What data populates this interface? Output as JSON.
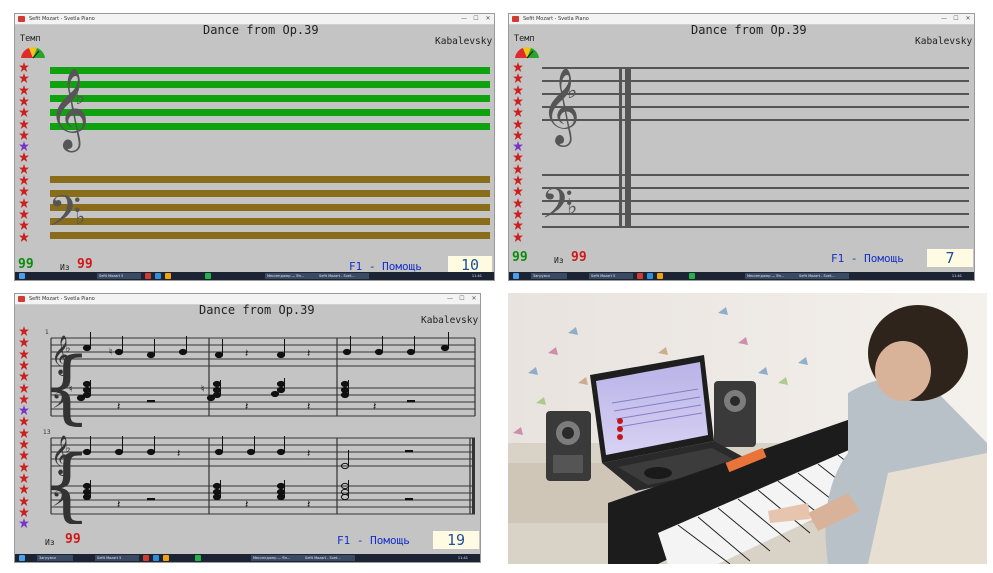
{
  "app": {
    "window_title": "Sefit Mozart - Svetla Piano",
    "window_title_short": "Sefit Mozart - Svetla Piano"
  },
  "song": {
    "title": "Dance from Op.39",
    "composer": "Kabalevsky"
  },
  "ui": {
    "tempo_label": "Темп",
    "of_label": "Из",
    "help_link": "F1 - Помощь",
    "total": "99"
  },
  "panels": [
    {
      "remaining": "99",
      "counter": "10"
    },
    {
      "remaining": "99",
      "counter": "7"
    },
    {
      "remaining": "",
      "counter": "19"
    }
  ],
  "score": {
    "measure_label_row1": "1",
    "measure_label_row2": "13"
  },
  "taskbar": {
    "search_label": "Загрузки",
    "app_label": "Sefit Mozart 5",
    "browser_label": "Мессенджер — Ян...",
    "running_label": "Sefit Mozart - Svet...",
    "clock": "11:41"
  },
  "colors": {
    "panel_bg": "#c4c4c4",
    "treble_staff": "#0ea30e",
    "bass_staff": "#8a6d1a",
    "help_link": "#1430c8",
    "total": "#d01818",
    "remaining": "#0a8c0a",
    "counter_bg": "#fffbe3"
  },
  "icons": {
    "window": [
      "minimize-icon",
      "maximize-icon",
      "close-icon"
    ],
    "tempo": "tempo-gauge-icon",
    "progress": "flower-icon",
    "clefs": [
      "treble-clef-icon",
      "bass-clef-icon"
    ]
  }
}
